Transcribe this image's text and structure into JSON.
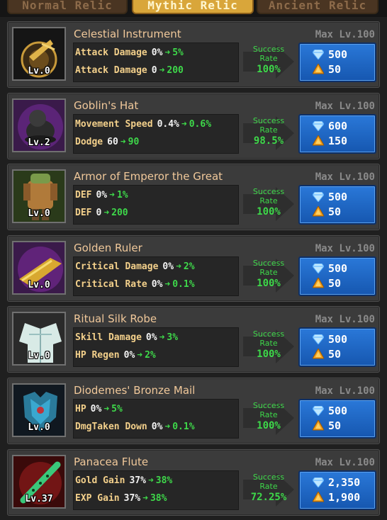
{
  "tabs": [
    {
      "label": "Normal Relic",
      "active": false
    },
    {
      "label": "Mythic Relic",
      "active": true
    },
    {
      "label": "Ancient Relic",
      "active": false
    }
  ],
  "colors": {
    "accent_green": "#3ed84a",
    "name": "#f0c89a",
    "stat_label": "#f3d08b",
    "cost_button": "#2a78d8"
  },
  "relics": [
    {
      "name": "Celestial Instrument",
      "level": "Lv.0",
      "max_level": "Max Lv.100",
      "icon": "celestial-instrument-icon",
      "stats": [
        {
          "label": "Attack Damage",
          "current": "0%",
          "next": "5%"
        },
        {
          "label": "Attack Damage",
          "current": "0",
          "next": "200"
        }
      ],
      "success_label": "Success Rate",
      "success_rate": "100%",
      "gem_cost": "500",
      "crystal_cost": "50"
    },
    {
      "name": "Goblin's Hat",
      "level": "Lv.2",
      "max_level": "Max Lv.100",
      "icon": "goblin-hat-icon",
      "stats": [
        {
          "label": "Movement Speed",
          "current": "0.4%",
          "next": "0.6%"
        },
        {
          "label": "Dodge",
          "current": "60",
          "next": "90"
        }
      ],
      "success_label": "Success Rate",
      "success_rate": "98.5%",
      "gem_cost": "600",
      "crystal_cost": "150"
    },
    {
      "name": "Armor of Emperor the Great",
      "level": "Lv.0",
      "max_level": "Max Lv.100",
      "icon": "emperor-armor-icon",
      "stats": [
        {
          "label": "DEF",
          "current": "0%",
          "next": "1%"
        },
        {
          "label": "DEF",
          "current": "0",
          "next": "200"
        }
      ],
      "success_label": "Success Rate",
      "success_rate": "100%",
      "gem_cost": "500",
      "crystal_cost": "50"
    },
    {
      "name": "Golden Ruler",
      "level": "Lv.0",
      "max_level": "Max Lv.100",
      "icon": "golden-ruler-icon",
      "stats": [
        {
          "label": "Critical Damage",
          "current": "0%",
          "next": "2%"
        },
        {
          "label": "Critical Rate",
          "current": "0%",
          "next": "0.1%"
        }
      ],
      "success_label": "Success Rate",
      "success_rate": "100%",
      "gem_cost": "500",
      "crystal_cost": "50"
    },
    {
      "name": "Ritual Silk Robe",
      "level": "Lv.0",
      "max_level": "Max Lv.100",
      "icon": "silk-robe-icon",
      "stats": [
        {
          "label": "Skill Damage",
          "current": "0%",
          "next": "3%"
        },
        {
          "label": "HP Regen",
          "current": "0%",
          "next": "2%"
        }
      ],
      "success_label": "Success Rate",
      "success_rate": "100%",
      "gem_cost": "500",
      "crystal_cost": "50"
    },
    {
      "name": "Diodemes' Bronze Mail",
      "level": "Lv.0",
      "max_level": "Max Lv.100",
      "icon": "bronze-mail-icon",
      "stats": [
        {
          "label": "HP",
          "current": "0%",
          "next": "5%"
        },
        {
          "label": "DmgTaken Down",
          "current": "0%",
          "next": "0.1%"
        }
      ],
      "success_label": "Success Rate",
      "success_rate": "100%",
      "gem_cost": "500",
      "crystal_cost": "50"
    },
    {
      "name": "Panacea Flute",
      "level": "Lv.37",
      "max_level": "Max Lv.100",
      "icon": "panacea-flute-icon",
      "stats": [
        {
          "label": "Gold Gain",
          "current": "37%",
          "next": "38%"
        },
        {
          "label": "EXP Gain",
          "current": "37%",
          "next": "38%"
        }
      ],
      "success_label": "Success Rate",
      "success_rate": "72.25%",
      "gem_cost": "2,350",
      "crystal_cost": "1,900"
    }
  ]
}
